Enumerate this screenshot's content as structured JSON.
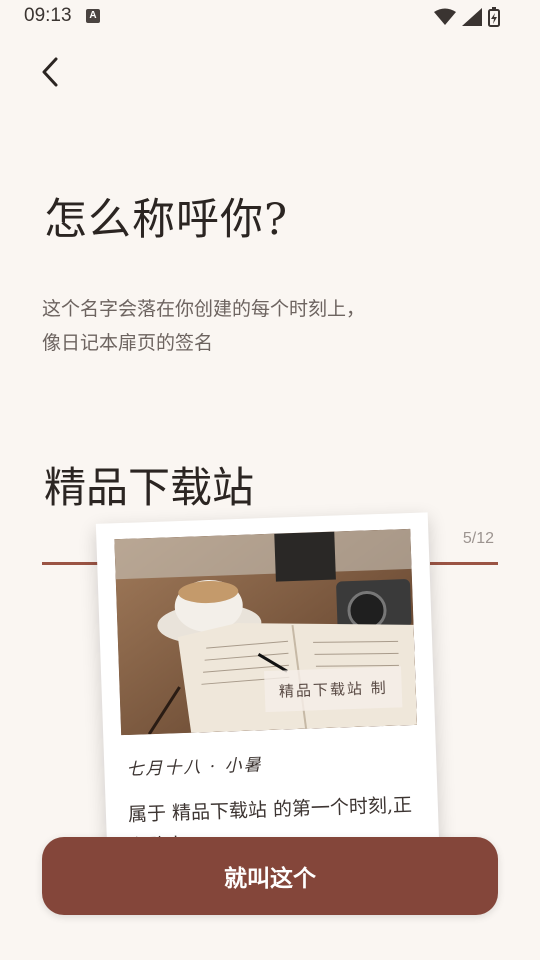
{
  "status_bar": {
    "time": "09:13",
    "keyboard_badge": "A"
  },
  "header": {
    "back_icon": "chevron-left-icon"
  },
  "title": "怎么称呼你?",
  "subtitle": {
    "line1": "这个名字会落在你创建的每个时刻上，",
    "line2": "像日记本扉页的签名"
  },
  "name_input": {
    "value": "精品下载站",
    "counter": "5/12"
  },
  "preview_card": {
    "photo_badge": "精品下载站 制",
    "date": "七月十八 · 小暑",
    "text": "属于 精品下载站 的第一个时刻,正在路上"
  },
  "primary_button": {
    "label": "就叫这个"
  },
  "colors": {
    "accent": "#84463a",
    "underline": "#9b5444",
    "background": "#faf6f2"
  }
}
